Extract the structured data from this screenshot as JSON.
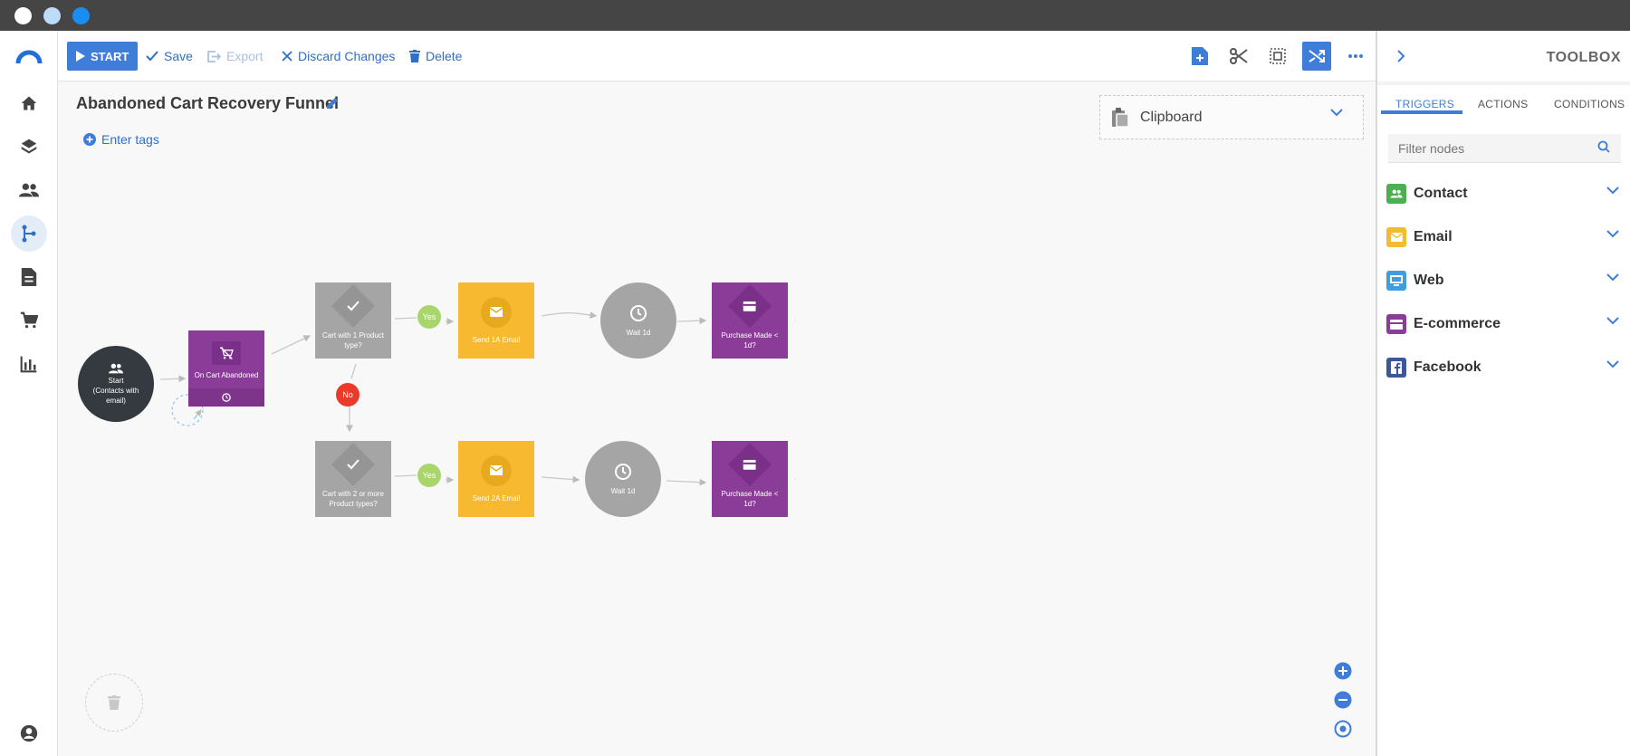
{
  "window": {
    "dot_colors": [
      "#ffffff",
      "#bcdcf8",
      "#1a8ef0"
    ]
  },
  "nav": {
    "items": [
      "logo-icon",
      "home-icon",
      "layers-icon",
      "contacts-icon",
      "flow-icon",
      "document-icon",
      "cart-icon",
      "chart-icon",
      "account-icon"
    ],
    "active": "flow-icon"
  },
  "toolbar": {
    "start_label": "START",
    "save_label": "Save",
    "export_label": "Export",
    "discard_label": "Discard Changes",
    "delete_label": "Delete",
    "icons": [
      "add-note-icon",
      "scissors-icon",
      "select-area-icon",
      "shuffle-icon",
      "more-icon"
    ]
  },
  "funnel": {
    "title": "Abandoned Cart Recovery Funnel",
    "tags_label": "Enter tags"
  },
  "clipboard": {
    "label": "Clipboard"
  },
  "nodes": {
    "start": "Start\n(Contacts with email)",
    "trigger": "On Cart Abandoned",
    "cond1": "Cart with 1 Product type?",
    "cond2": "Cart with 2 or more Product types?",
    "email1": "Send 1A Email",
    "email2": "Send 2A Email",
    "wait1": "Wait 1d",
    "wait2": "Wait 1d",
    "purchase1": "Purchase Made < 1d?",
    "purchase2": "Purchase Made < 1d?",
    "yes1": "Yes",
    "yes2": "Yes",
    "no": "No"
  },
  "colors": {
    "accent": "#3f7ed8",
    "dark_node": "#353a40",
    "purple": "#8b3c98",
    "gray_node": "#a5a5a5",
    "yellow": "#f6b92f",
    "yes_green": "#a8d66b",
    "no_red": "#ea3b2a"
  },
  "toolbox": {
    "title": "TOOLBOX",
    "tabs": [
      "TRIGGERS",
      "ACTIONS",
      "CONDITIONS"
    ],
    "active_tab": "TRIGGERS",
    "filter_placeholder": "Filter nodes",
    "categories": [
      {
        "label": "Contact",
        "icon": "contacts-icon",
        "color": "#4caf50"
      },
      {
        "label": "Email",
        "icon": "email-icon",
        "color": "#f6b92f"
      },
      {
        "label": "Web",
        "icon": "monitor-icon",
        "color": "#3f9de0"
      },
      {
        "label": "E-commerce",
        "icon": "card-icon",
        "color": "#8b3c98"
      },
      {
        "label": "Facebook",
        "icon": "facebook-icon",
        "color": "#3b5998"
      }
    ]
  }
}
